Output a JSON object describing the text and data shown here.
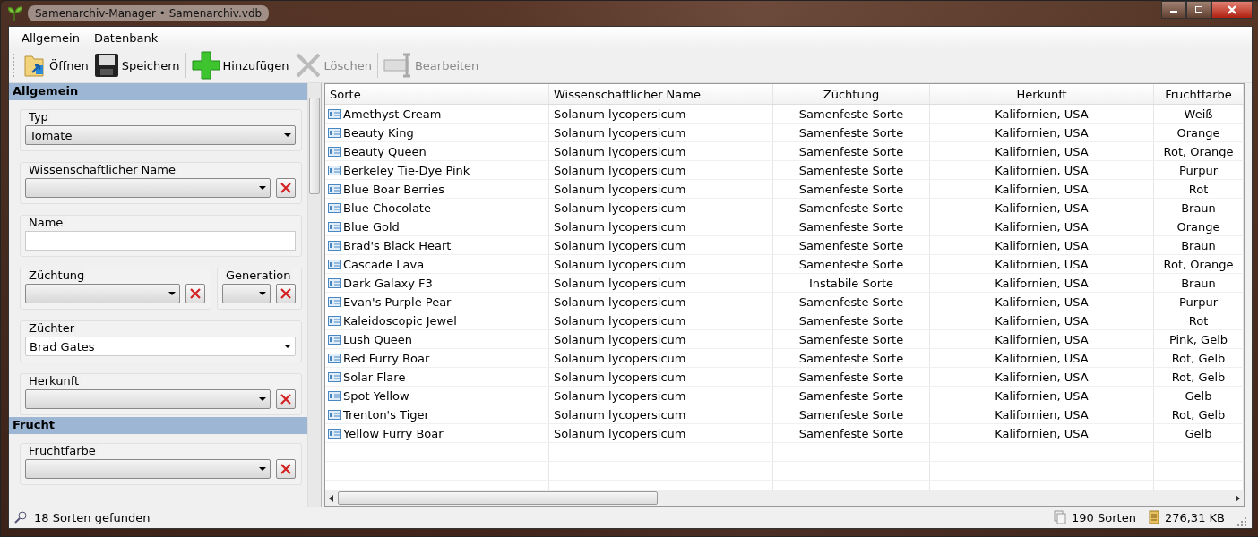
{
  "window": {
    "title": "Samenarchiv-Manager • Samenarchiv.vdb"
  },
  "menu": [
    "Allgemein",
    "Datenbank"
  ],
  "toolbar": [
    {
      "label": "Öffnen",
      "disabled": false,
      "separator_before": false
    },
    {
      "label": "Speichern",
      "disabled": false,
      "separator_before": false
    },
    {
      "label": "Hinzufügen",
      "disabled": false,
      "separator_before": true
    },
    {
      "label": "Löschen",
      "disabled": true,
      "separator_before": false
    },
    {
      "label": "Bearbeiten",
      "disabled": true,
      "separator_before": true
    }
  ],
  "sidebar": {
    "sections": [
      {
        "title": "Allgemein",
        "rows": [
          [
            {
              "label": "Typ",
              "kind": "combo",
              "value": "Tomate",
              "clear_button": false
            }
          ],
          [
            {
              "label": "Wissenschaftlicher Name",
              "kind": "combo",
              "clear_button": true
            }
          ],
          [
            {
              "label": "Name",
              "kind": "text",
              "clear_button": false
            }
          ],
          [
            {
              "label": "Züchtung",
              "kind": "combo",
              "clear_button": true
            },
            {
              "label": "Generation",
              "kind": "combo",
              "clear_button": true
            }
          ],
          [
            {
              "label": "Züchter",
              "kind": "editable",
              "value": "Brad Gates",
              "clear_button": false
            }
          ],
          [
            {
              "label": "Herkunft",
              "kind": "combo",
              "clear_button": true
            }
          ]
        ]
      },
      {
        "title": "Frucht",
        "rows": [
          [
            {
              "label": "Fruchtfarbe",
              "kind": "combo",
              "clear_button": true
            }
          ]
        ]
      }
    ]
  },
  "table": {
    "columns": [
      "Sorte",
      "Wissenschaftlicher Name",
      "Züchtung",
      "Herkunft",
      "Fruchtfarbe"
    ],
    "rows": [
      [
        "Amethyst Cream",
        "Solanum lycopersicum",
        "Samenfeste Sorte",
        "Kalifornien, USA",
        "Weiß"
      ],
      [
        "Beauty King",
        "Solanum lycopersicum",
        "Samenfeste Sorte",
        "Kalifornien, USA",
        "Orange"
      ],
      [
        "Beauty Queen",
        "Solanum lycopersicum",
        "Samenfeste Sorte",
        "Kalifornien, USA",
        "Rot, Orange"
      ],
      [
        "Berkeley Tie-Dye Pink",
        "Solanum lycopersicum",
        "Samenfeste Sorte",
        "Kalifornien, USA",
        "Purpur"
      ],
      [
        "Blue Boar Berries",
        "Solanum lycopersicum",
        "Samenfeste Sorte",
        "Kalifornien, USA",
        "Rot"
      ],
      [
        "Blue Chocolate",
        "Solanum lycopersicum",
        "Samenfeste Sorte",
        "Kalifornien, USA",
        "Braun"
      ],
      [
        "Blue Gold",
        "Solanum lycopersicum",
        "Samenfeste Sorte",
        "Kalifornien, USA",
        "Orange"
      ],
      [
        "Brad's Black Heart",
        "Solanum lycopersicum",
        "Samenfeste Sorte",
        "Kalifornien, USA",
        "Braun"
      ],
      [
        "Cascade Lava",
        "Solanum lycopersicum",
        "Samenfeste Sorte",
        "Kalifornien, USA",
        "Rot, Orange"
      ],
      [
        "Dark Galaxy F3",
        "Solanum lycopersicum",
        "Instabile Sorte",
        "Kalifornien, USA",
        "Braun"
      ],
      [
        "Evan's Purple Pear",
        "Solanum lycopersicum",
        "Samenfeste Sorte",
        "Kalifornien, USA",
        "Purpur"
      ],
      [
        "Kaleidoscopic Jewel",
        "Solanum lycopersicum",
        "Samenfeste Sorte",
        "Kalifornien, USA",
        "Rot"
      ],
      [
        "Lush Queen",
        "Solanum lycopersicum",
        "Samenfeste Sorte",
        "Kalifornien, USA",
        "Pink, Gelb"
      ],
      [
        "Red Furry Boar",
        "Solanum lycopersicum",
        "Samenfeste Sorte",
        "Kalifornien, USA",
        "Rot, Gelb"
      ],
      [
        "Solar Flare",
        "Solanum lycopersicum",
        "Samenfeste Sorte",
        "Kalifornien, USA",
        "Rot, Gelb"
      ],
      [
        "Spot Yellow",
        "Solanum lycopersicum",
        "Samenfeste Sorte",
        "Kalifornien, USA",
        "Gelb"
      ],
      [
        "Trenton's Tiger",
        "Solanum lycopersicum",
        "Samenfeste Sorte",
        "Kalifornien, USA",
        "Rot, Gelb"
      ],
      [
        "Yellow Furry Boar",
        "Solanum lycopersicum",
        "Samenfeste Sorte",
        "Kalifornien, USA",
        "Gelb"
      ]
    ]
  },
  "status_bar": {
    "result": "18 Sorten gefunden",
    "count": "190 Sorten",
    "size": "276,31 KB"
  }
}
